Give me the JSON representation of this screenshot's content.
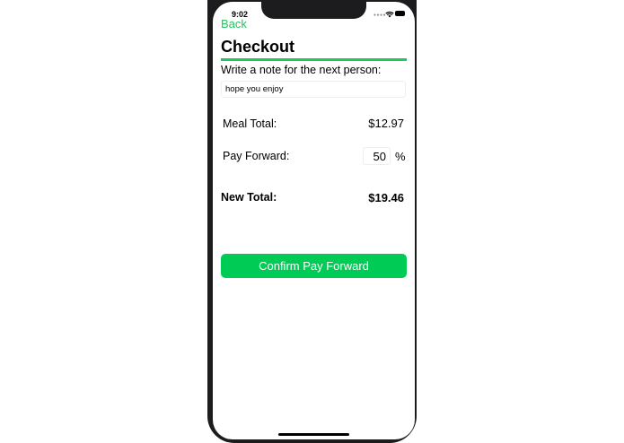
{
  "status_bar": {
    "time": "9:02",
    "signal_icon": "signal-dots",
    "wifi_icon": "wifi",
    "battery_icon": "battery"
  },
  "nav": {
    "back_label": "Back"
  },
  "page": {
    "title": "Checkout"
  },
  "note": {
    "label": "Write a note for the next person:",
    "value": "hope you enjoy"
  },
  "meal_total": {
    "label": "Meal Total:",
    "value": "$12.97"
  },
  "pay_forward": {
    "label": "Pay Forward:",
    "value": "50",
    "unit": "%"
  },
  "new_total": {
    "label": "New Total:",
    "value": "$19.46"
  },
  "confirm": {
    "label": "Confirm Pay Forward"
  },
  "colors": {
    "accent": "#22c55e",
    "button": "#00cc55",
    "frame": "#1c1c1e"
  }
}
